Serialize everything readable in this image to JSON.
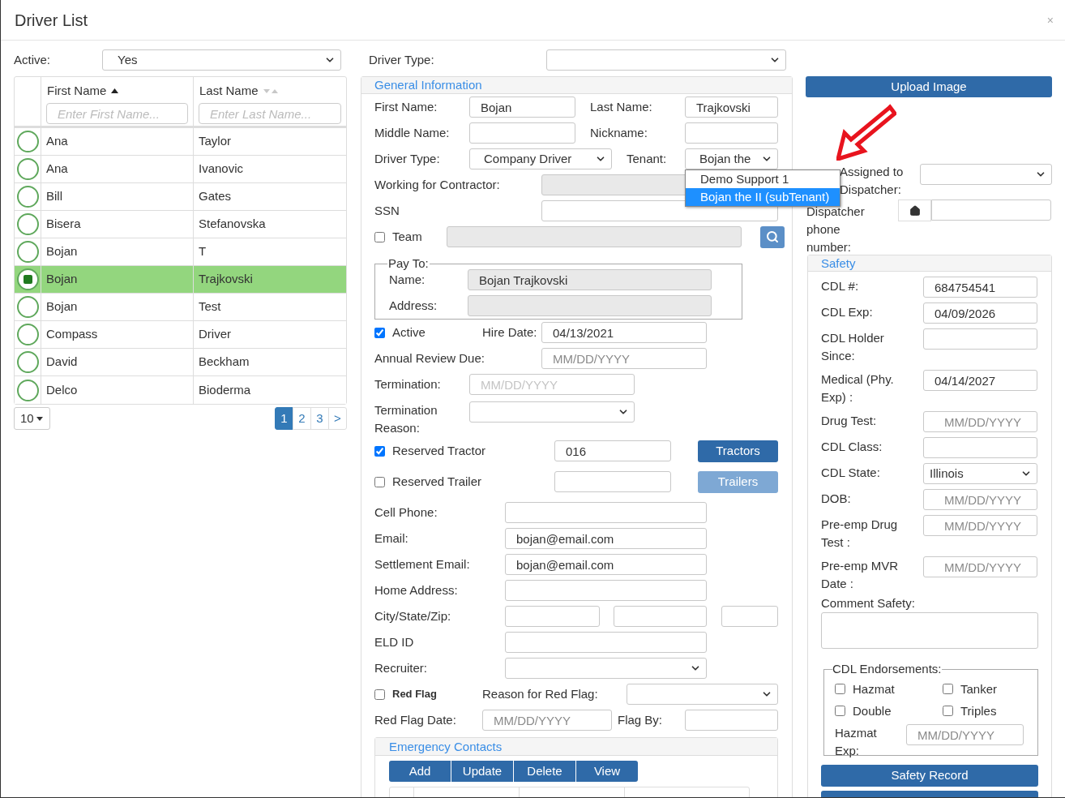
{
  "window": {
    "title": "Driver List",
    "close": "×"
  },
  "filters": {
    "active": {
      "label": "Active:",
      "value": "Yes"
    },
    "driver_type": {
      "label": "Driver Type:"
    }
  },
  "table": {
    "columns": [
      {
        "label": "First Name",
        "sorted": true,
        "placeholder": "Enter First Name..."
      },
      {
        "label": "Last Name",
        "sorted": false,
        "placeholder": "Enter Last Name..."
      }
    ],
    "rows": [
      {
        "first": "Ana",
        "last": "Taylor",
        "selected": false
      },
      {
        "first": "Ana",
        "last": "Ivanovic",
        "selected": false
      },
      {
        "first": "Bill",
        "last": "Gates",
        "selected": false
      },
      {
        "first": "Bisera",
        "last": "Stefanovska",
        "selected": false
      },
      {
        "first": "Bojan",
        "last": "T",
        "selected": false
      },
      {
        "first": "Bojan",
        "last": "Trajkovski",
        "selected": true
      },
      {
        "first": "Bojan",
        "last": "Test",
        "selected": false
      },
      {
        "first": "Compass",
        "last": "Driver",
        "selected": false
      },
      {
        "first": "David",
        "last": "Beckham",
        "selected": false
      },
      {
        "first": "Delco",
        "last": "Bioderma",
        "selected": false
      }
    ]
  },
  "pagination": {
    "page_size": "10",
    "pages": [
      {
        "label": "1",
        "selected": true
      },
      {
        "label": "2",
        "selected": false
      },
      {
        "label": "3",
        "selected": false
      },
      {
        "label": ">",
        "selected": false
      }
    ]
  },
  "general": {
    "title": "General Information",
    "first_name": {
      "label": "First Name:",
      "value": "Bojan"
    },
    "last_name": {
      "label": "Last Name:",
      "value": "Trajkovski"
    },
    "middle_name": {
      "label": "Middle Name:"
    },
    "nickname": {
      "label": "Nickname:"
    },
    "driver_type": {
      "label": "Driver Type:",
      "value": "Company Driver"
    },
    "tenant": {
      "label": "Tenant:",
      "value": "Bojan the",
      "expanded": true,
      "options": [
        {
          "label": "Demo Support 1",
          "selected": false
        },
        {
          "label": "Bojan the II (subTenant)",
          "selected": true
        }
      ]
    },
    "contractor": {
      "label": "Working for Contractor:",
      "disabled": true
    },
    "ssn": {
      "label": "SSN"
    },
    "team": {
      "label": "Team",
      "checked": false,
      "disabled": true
    },
    "pay_to": {
      "legend": "Pay To:",
      "name": {
        "label": "Name:",
        "value": "Bojan Trajkovski",
        "disabled": true
      },
      "address": {
        "label": "Address:",
        "disabled": true
      }
    },
    "active": {
      "label": "Active",
      "checked": true
    },
    "hire_date": {
      "label": "Hire Date:",
      "value": "04/13/2021"
    },
    "annual_review": {
      "label": "Annual Review Due:",
      "placeholder": "MM/DD/YYYY"
    },
    "termination": {
      "label": "Termination:",
      "placeholder": "MM/DD/YYYY"
    },
    "termination_reason": {
      "label": "Termination Reason:"
    },
    "reserved_tractor": {
      "label": "Reserved Tractor",
      "checked": true,
      "value": "016",
      "button": "Tractors",
      "disabled": false
    },
    "reserved_trailer": {
      "label": "Reserved Trailer",
      "checked": false,
      "button": "Trailers",
      "disabled": true
    },
    "cell_phone": {
      "label": "Cell Phone:"
    },
    "email": {
      "label": "Email:",
      "value": "bojan@email.com"
    },
    "settlement_email": {
      "label": "Settlement Email:",
      "value": "bojan@email.com"
    },
    "home_address": {
      "label": "Home Address:"
    },
    "city_state_zip": {
      "label": "City/State/Zip:"
    },
    "eld_id": {
      "label": "ELD ID"
    },
    "recruiter": {
      "label": "Recruiter:"
    },
    "red_flag": {
      "label": "Red Flag",
      "checked": false
    },
    "red_flag_reason": {
      "label": "Reason for Red Flag:"
    },
    "red_flag_date": {
      "label": "Red Flag Date:",
      "placeholder": "MM/DD/YYYY"
    },
    "flag_by": {
      "label": "Flag By:"
    }
  },
  "emergency_contacts": {
    "title": "Emergency Contacts",
    "buttons": [
      "Add",
      "Update",
      "Delete",
      "View"
    ]
  },
  "right": {
    "upload_button": "Upload Image",
    "assigned_dispatcher": {
      "label": "Assigned to Dispatcher:"
    },
    "dispatcher_phone": {
      "label": "Dispatcher phone number:"
    }
  },
  "safety": {
    "title": "Safety",
    "fields": [
      {
        "kind": "input",
        "label": "CDL #:",
        "value": "684754541"
      },
      {
        "kind": "input",
        "label": "CDL Exp:",
        "value": "04/09/2026"
      },
      {
        "kind": "input",
        "label": "CDL Holder Since:"
      },
      {
        "kind": "input",
        "label": "Medical (Phy. Exp) :",
        "value": "04/14/2027"
      },
      {
        "kind": "input",
        "label": "Drug Test:",
        "placeholder": "MM/DD/YYYY"
      },
      {
        "kind": "input",
        "label": "CDL Class:"
      },
      {
        "kind": "select",
        "label": "CDL State:",
        "value": "Illinois"
      },
      {
        "kind": "input",
        "label": "DOB:",
        "placeholder": "MM/DD/YYYY"
      },
      {
        "kind": "input",
        "label": "Pre-emp Drug Test :",
        "placeholder": "MM/DD/YYYY"
      },
      {
        "kind": "input",
        "label": "Pre-emp MVR Date :",
        "placeholder": "MM/DD/YYYY"
      }
    ],
    "comment": {
      "label": "Comment Safety:"
    },
    "endorsements": {
      "legend": "CDL Endorsements:",
      "items": [
        {
          "label": "Hazmat",
          "checked": false
        },
        {
          "label": "Tanker",
          "checked": false
        },
        {
          "label": "Double",
          "checked": false
        },
        {
          "label": "Triples",
          "checked": false
        }
      ],
      "hazmat_exp": {
        "label": "Hazmat Exp:",
        "placeholder": "MM/DD/YYYY"
      }
    },
    "record_button": "Safety Record"
  }
}
